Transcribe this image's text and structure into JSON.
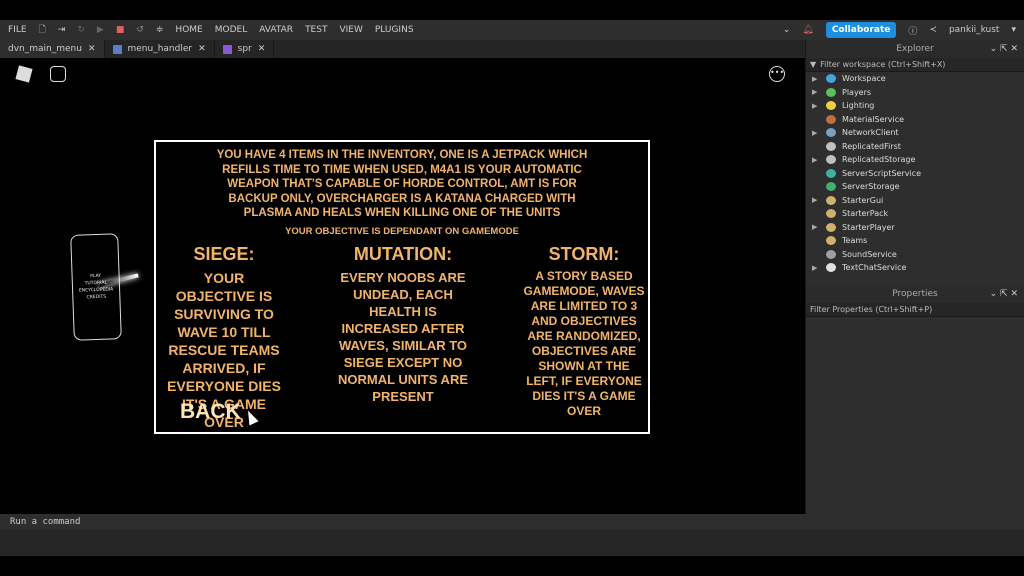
{
  "menubar": {
    "file": "FILE",
    "items": [
      "HOME",
      "MODEL",
      "AVATAR",
      "TEST",
      "VIEW",
      "PLUGINS"
    ],
    "collaborate": "Collaborate",
    "user": "pankii_kust"
  },
  "tabs": [
    {
      "label": "dvn_main_menu"
    },
    {
      "label": "menu_handler"
    },
    {
      "label": "spr"
    }
  ],
  "explorer": {
    "title": "Explorer",
    "filter": "Filter workspace (Ctrl+Shift+X)",
    "items": [
      {
        "label": "Workspace",
        "color": "#4aa3df",
        "exp": true
      },
      {
        "label": "Players",
        "color": "#5bbf5b",
        "exp": true
      },
      {
        "label": "Lighting",
        "color": "#f0d040",
        "exp": true
      },
      {
        "label": "MaterialService",
        "color": "#c07040",
        "exp": false
      },
      {
        "label": "NetworkClient",
        "color": "#7aa0c0",
        "exp": true
      },
      {
        "label": "ReplicatedFirst",
        "color": "#c0c0c0",
        "exp": false
      },
      {
        "label": "ReplicatedStorage",
        "color": "#c0c0c0",
        "exp": true
      },
      {
        "label": "ServerScriptService",
        "color": "#40b0a0",
        "exp": false
      },
      {
        "label": "ServerStorage",
        "color": "#40b070",
        "exp": false
      },
      {
        "label": "StarterGui",
        "color": "#d0b070",
        "exp": true
      },
      {
        "label": "StarterPack",
        "color": "#d0b070",
        "exp": false
      },
      {
        "label": "StarterPlayer",
        "color": "#d0b070",
        "exp": true
      },
      {
        "label": "Teams",
        "color": "#d0b070",
        "exp": false
      },
      {
        "label": "SoundService",
        "color": "#a0a0a0",
        "exp": false
      },
      {
        "label": "TextChatService",
        "color": "#e0e0e0",
        "exp": true
      }
    ]
  },
  "properties": {
    "title": "Properties",
    "filter": "Filter Properties (Ctrl+Shift+P)"
  },
  "phone_menu": [
    "PLAY",
    "TUTORIAL",
    "ENCYCLOPEDIA",
    "CREDITS"
  ],
  "panel": {
    "intro": "YOU HAVE 4 ITEMS IN THE INVENTORY, ONE IS A JETPACK WHICH REFILLS TIME TO TIME WHEN USED, M4A1 IS YOUR AUTOMATIC WEAPON THAT'S CAPABLE OF HORDE CONTROL, AMT IS FOR BACKUP ONLY, OVERCHARGER IS A KATANA CHARGED WITH PLASMA AND HEALS WHEN KILLING ONE OF THE UNITS",
    "objective": "YOUR OBJECTIVE IS DEPENDANT ON GAMEMODE",
    "siege": {
      "title": "SIEGE:",
      "text": "YOUR OBJECTIVE IS SURVIVING TO WAVE 10 TILL RESCUE TEAMS ARRIVED, IF EVERYONE DIES IT'S A GAME OVER"
    },
    "mutation": {
      "title": "MUTATION:",
      "text": "EVERY NOOBS ARE UNDEAD, EACH HEALTH IS INCREASED AFTER WAVES, SIMILAR TO SIEGE EXCEPT NO NORMAL UNITS ARE PRESENT"
    },
    "storm": {
      "title": "STORM:",
      "text": "A STORY BASED GAMEMODE, WAVES ARE LIMITED TO 3 AND OBJECTIVES ARE RANDOMIZED, OBJECTIVES ARE SHOWN AT THE LEFT, IF EVERYONE DIES IT'S A GAME OVER"
    },
    "back": "BACK"
  },
  "command": {
    "placeholder": "Run a command"
  }
}
